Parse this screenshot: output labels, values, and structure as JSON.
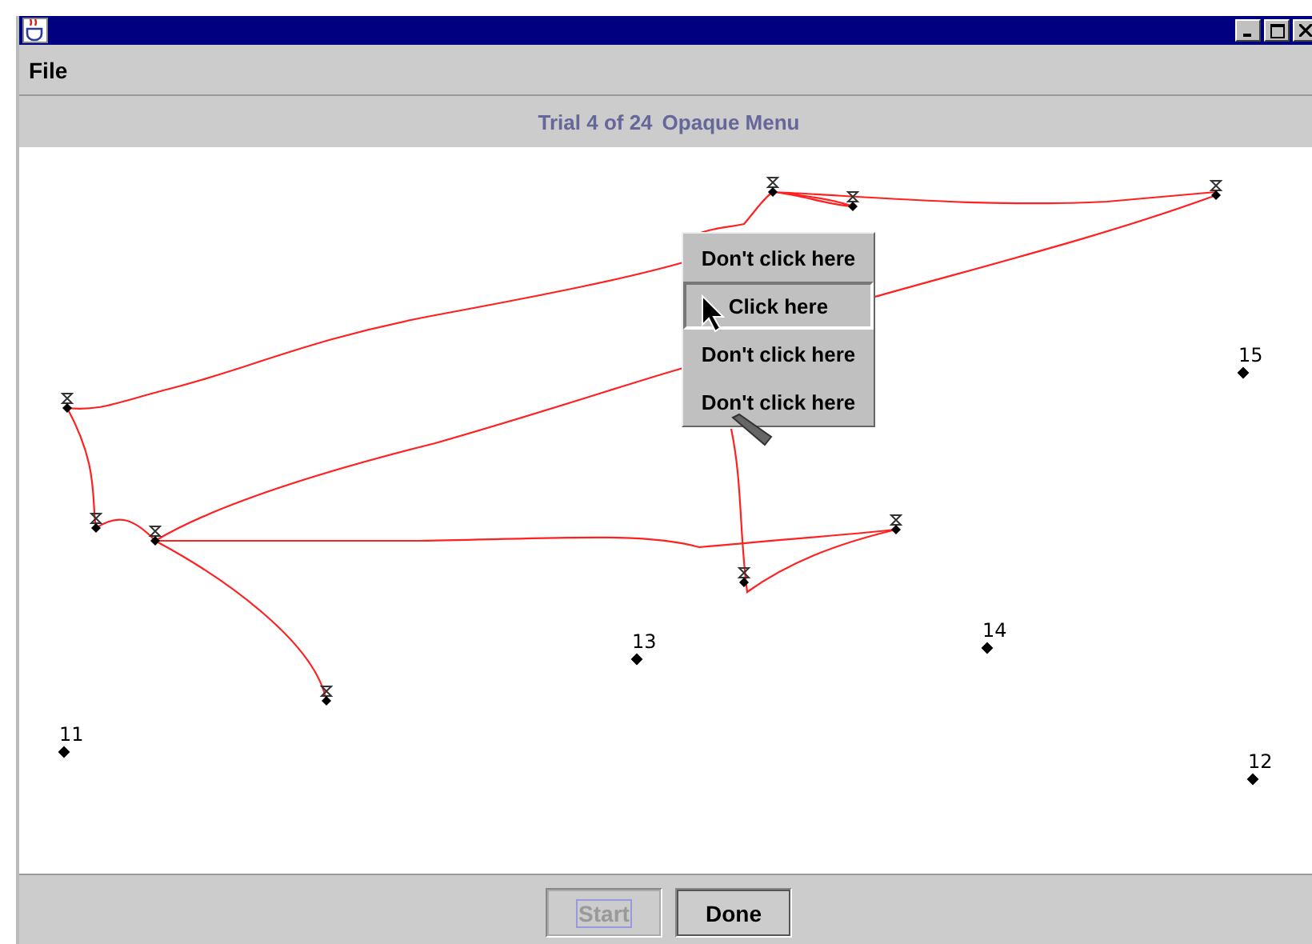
{
  "menu_bar": [
    "File"
  ],
  "header": {
    "trial": "Trial 4 of 24",
    "mode": "Opaque Menu"
  },
  "targets": [
    "11",
    "12",
    "13",
    "14",
    "15"
  ],
  "popup_menu": [
    {
      "label": "Don't click here",
      "selected": false
    },
    {
      "label": "Click here",
      "selected": true
    },
    {
      "label": "Don't click here",
      "selected": false
    },
    {
      "label": "Don't click here",
      "selected": false
    }
  ],
  "buttons": [
    {
      "label": "Start",
      "disabled": true
    },
    {
      "label": "Done",
      "disabled": false
    }
  ]
}
